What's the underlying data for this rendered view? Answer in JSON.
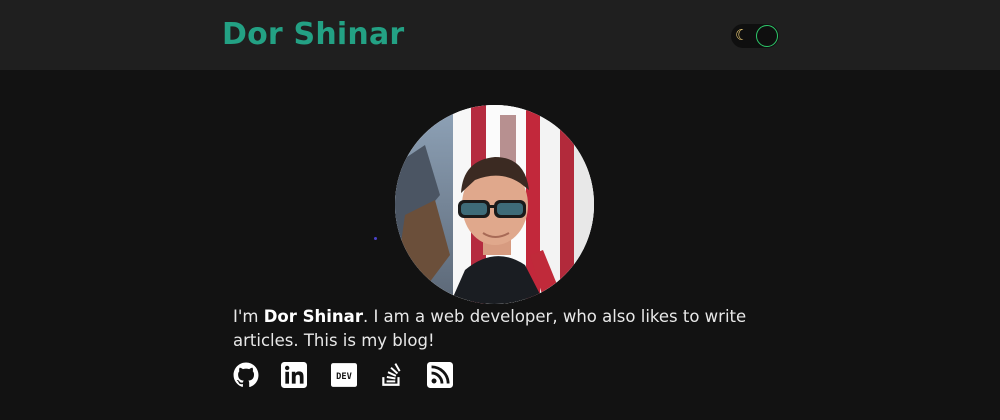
{
  "header": {
    "site_title": "Dor Shinar",
    "theme_toggle": {
      "icon": "moon-icon",
      "glyph": "☾",
      "accent_color": "#2ec96a"
    }
  },
  "colors": {
    "brand": "#23a184",
    "background": "#121212",
    "header_background": "#1f1f1f",
    "text": "#e8e8e8"
  },
  "bio": {
    "intro_prefix": "I'm ",
    "name": "Dor Shinar",
    "intro_suffix": ". I am a web developer, who also likes to write articles. This is my blog!"
  },
  "avatar": {
    "alt": "Dor Shinar"
  },
  "social_links": [
    {
      "icon": "github-icon"
    },
    {
      "icon": "linkedin-icon"
    },
    {
      "icon": "dev-icon",
      "label": "DEV"
    },
    {
      "icon": "stackoverflow-icon"
    },
    {
      "icon": "rss-icon"
    }
  ]
}
